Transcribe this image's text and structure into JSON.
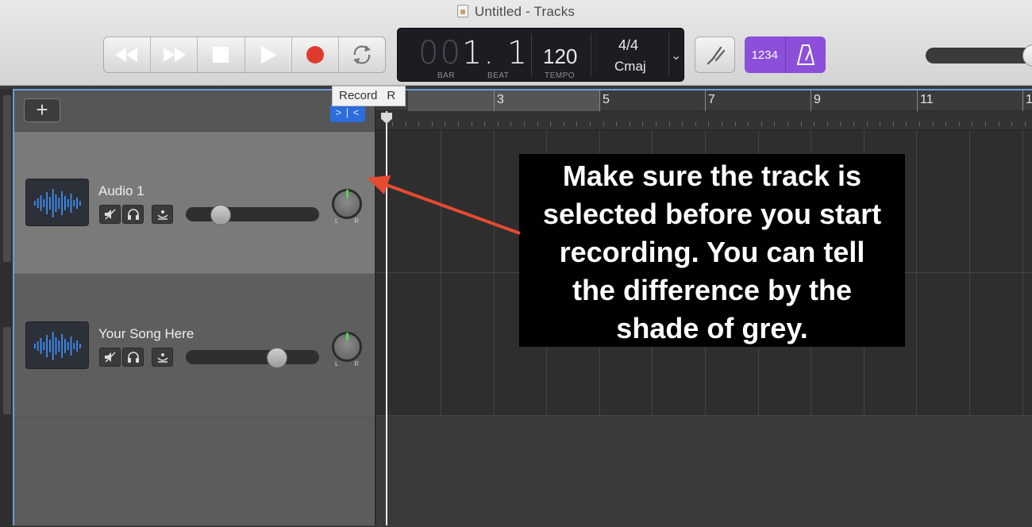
{
  "window": {
    "title": "Untitled - Tracks"
  },
  "transport": {
    "buttons": [
      "rewind",
      "fast-forward",
      "stop",
      "play",
      "record",
      "cycle"
    ]
  },
  "lcd": {
    "position_dim": "00",
    "position": "1. 1",
    "bar_label": "BAR",
    "beat_label": "BEAT",
    "tempo": "120",
    "tempo_label": "TEMPO",
    "signature": "4/4",
    "key": "Cmaj"
  },
  "count_in": {
    "label": "1234"
  },
  "tooltip": {
    "label": "Record",
    "shortcut": "R"
  },
  "header": {
    "add_label": "+",
    "fit_label": "> | <"
  },
  "ruler": {
    "bars": [
      "3",
      "5",
      "7",
      "9",
      "11",
      "1"
    ]
  },
  "tracks": [
    {
      "name": "Audio 1",
      "selected": true,
      "volume": 0.22
    },
    {
      "name": "Your Song Here",
      "selected": false,
      "volume": 0.72
    }
  ],
  "callout": {
    "lines": [
      "Make sure the track is",
      "selected before you start",
      "recording. You can tell",
      "the difference by the",
      "shade of grey."
    ]
  },
  "colors": {
    "record": "#e03a2f",
    "accent": "#8b4fd9",
    "selection": "#6b9bd6",
    "annotation_arrow": "#e54b32"
  }
}
